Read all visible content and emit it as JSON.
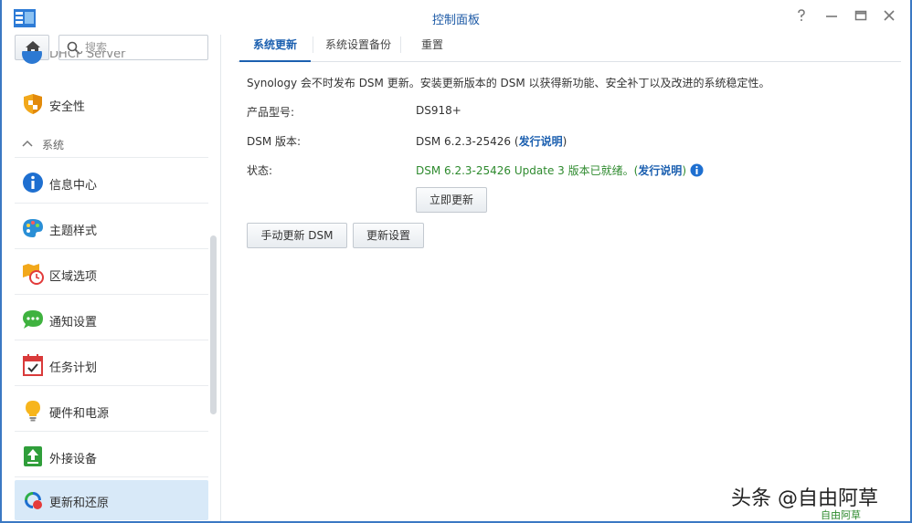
{
  "window": {
    "title": "控制面板",
    "controls": [
      "help-icon",
      "minimize-icon",
      "maximize-icon",
      "close-icon"
    ]
  },
  "sidebar": {
    "search_placeholder": "搜索",
    "partial_item_label": "DHCP Server",
    "top_items": [
      {
        "label": "安全性",
        "icon": "shield-icon"
      }
    ],
    "section": {
      "label": "系统",
      "icon": "chevron-up-icon"
    },
    "items": [
      {
        "label": "信息中心",
        "icon": "info-icon"
      },
      {
        "label": "主题样式",
        "icon": "palette-icon"
      },
      {
        "label": "区域选项",
        "icon": "region-clock-icon"
      },
      {
        "label": "通知设置",
        "icon": "chat-bubble-icon"
      },
      {
        "label": "任务计划",
        "icon": "calendar-check-icon"
      },
      {
        "label": "硬件和电源",
        "icon": "lightbulb-icon"
      },
      {
        "label": "外接设备",
        "icon": "external-device-icon"
      },
      {
        "label": "更新和还原",
        "icon": "update-restore-icon",
        "active": true
      }
    ]
  },
  "tabs": [
    {
      "label": "系统更新",
      "active": true
    },
    {
      "label": "系统设置备份",
      "active": false
    },
    {
      "label": "重置",
      "active": false
    }
  ],
  "update": {
    "description": "Synology 会不时发布 DSM 更新。安装更新版本的 DSM 以获得新功能、安全补丁以及改进的系统稳定性。",
    "model_label": "产品型号:",
    "model_value": "DS918+",
    "dsm_version_label": "DSM 版本:",
    "dsm_version_value": "DSM 6.2.3-25426 (",
    "release_notes_link": "发行说明",
    "close_paren": ")",
    "status_label": "状态:",
    "status_value": "DSM 6.2.3-25426 Update 3 版本已就绪。(",
    "status_release_notes_link": "发行说明",
    "status_close_paren": ")",
    "update_now_button": "立即更新",
    "manual_update_button": "手动更新 DSM",
    "update_settings_button": "更新设置"
  },
  "watermark": {
    "text": "头条 @自由阿草",
    "sub": "自由阿草"
  },
  "colors": {
    "accent": "#1c60b0",
    "active_bg": "#d8e9f8",
    "status_green": "#2e8a2e",
    "window_border": "#3a78c3"
  }
}
